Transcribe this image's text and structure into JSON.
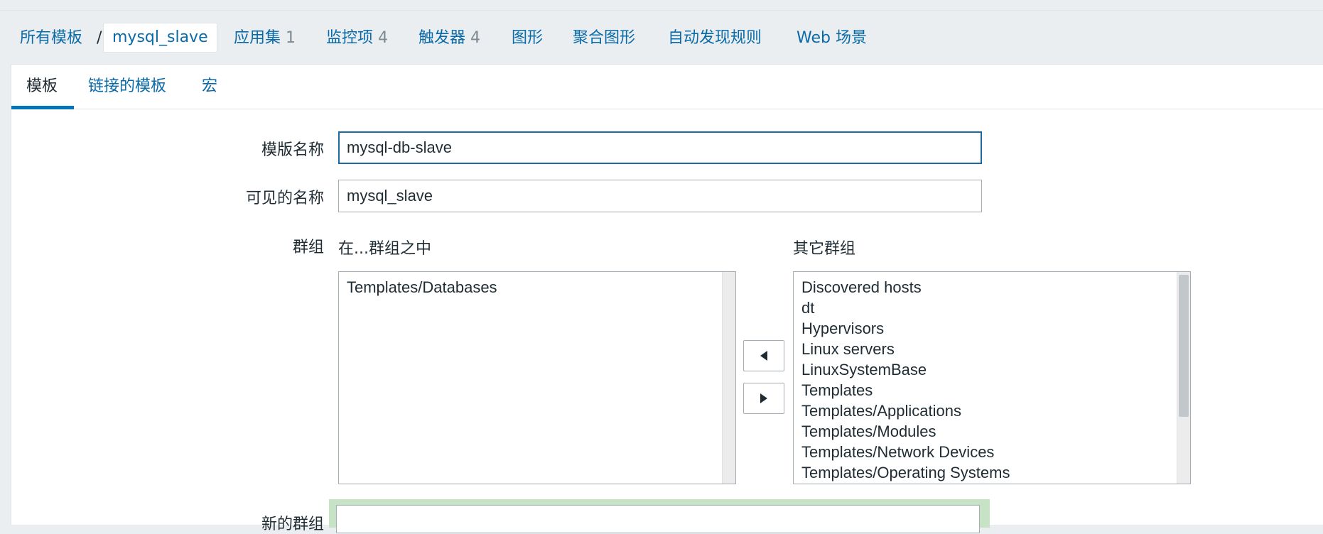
{
  "nav": {
    "all_templates": "所有模板",
    "separator": "/",
    "current_template": "mysql_slave",
    "applications": {
      "label": "应用集",
      "count": "1"
    },
    "items": {
      "label": "监控项",
      "count": "4"
    },
    "triggers": {
      "label": "触发器",
      "count": "4"
    },
    "graphs": "图形",
    "screens": "聚合图形",
    "discovery": "自动发现规则",
    "web": "Web 场景"
  },
  "tabs": [
    {
      "label": "模板",
      "active": true
    },
    {
      "label": "链接的模板",
      "active": false
    },
    {
      "label": "宏",
      "active": false
    }
  ],
  "form": {
    "template_name_label": "模版名称",
    "template_name_value": "mysql-db-slave",
    "visible_name_label": "可见的名称",
    "visible_name_value": "mysql_slave",
    "groups_label": "群组",
    "in_groups_label": "在...群组之中",
    "other_groups_label": "其它群组",
    "in_groups": [
      "Templates/Databases"
    ],
    "other_groups": [
      "Discovered hosts",
      "dt",
      "Hypervisors",
      "Linux servers",
      "LinuxSystemBase",
      "Templates",
      "Templates/Applications",
      "Templates/Modules",
      "Templates/Network Devices",
      "Templates/Operating Systems"
    ],
    "new_group_label": "新的群组",
    "new_group_value": ""
  },
  "colors": {
    "link": "#0a6aa8",
    "active_tab_underline": "#0275b8",
    "focus_border": "#1a6aa6",
    "new_group_highlight": "#c7e3c6"
  }
}
